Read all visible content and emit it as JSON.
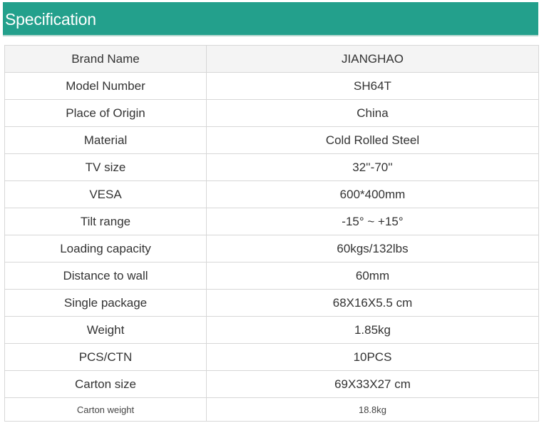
{
  "header": {
    "title": "Specification"
  },
  "spec": {
    "rows": [
      {
        "label": "Brand Name",
        "value": "JIANGHAO"
      },
      {
        "label": "Model Number",
        "value": "SH64T"
      },
      {
        "label": "Place of Origin",
        "value": "China"
      },
      {
        "label": "Material",
        "value": "Cold Rolled Steel"
      },
      {
        "label": "TV size",
        "value": "32''-70''"
      },
      {
        "label": "VESA",
        "value": "600*400mm"
      },
      {
        "label": "Tilt range",
        "value": "-15° ~ +15°"
      },
      {
        "label": "Loading capacity",
        "value": "60kgs/132lbs"
      },
      {
        "label": "Distance to wall",
        "value": "60mm"
      },
      {
        "label": "Single package",
        "value": "68X16X5.5 cm"
      },
      {
        "label": "Weight",
        "value": "1.85kg"
      },
      {
        "label": "PCS/CTN",
        "value": "10PCS"
      },
      {
        "label": "Carton size",
        "value": "69X33X27 cm"
      },
      {
        "label": "Carton weight",
        "value": "18.8kg"
      }
    ]
  },
  "colors": {
    "header_background": "#23a08c",
    "header_text": "#ffffff",
    "table_border": "#d7d7d7",
    "first_row_background": "#f4f4f4"
  }
}
